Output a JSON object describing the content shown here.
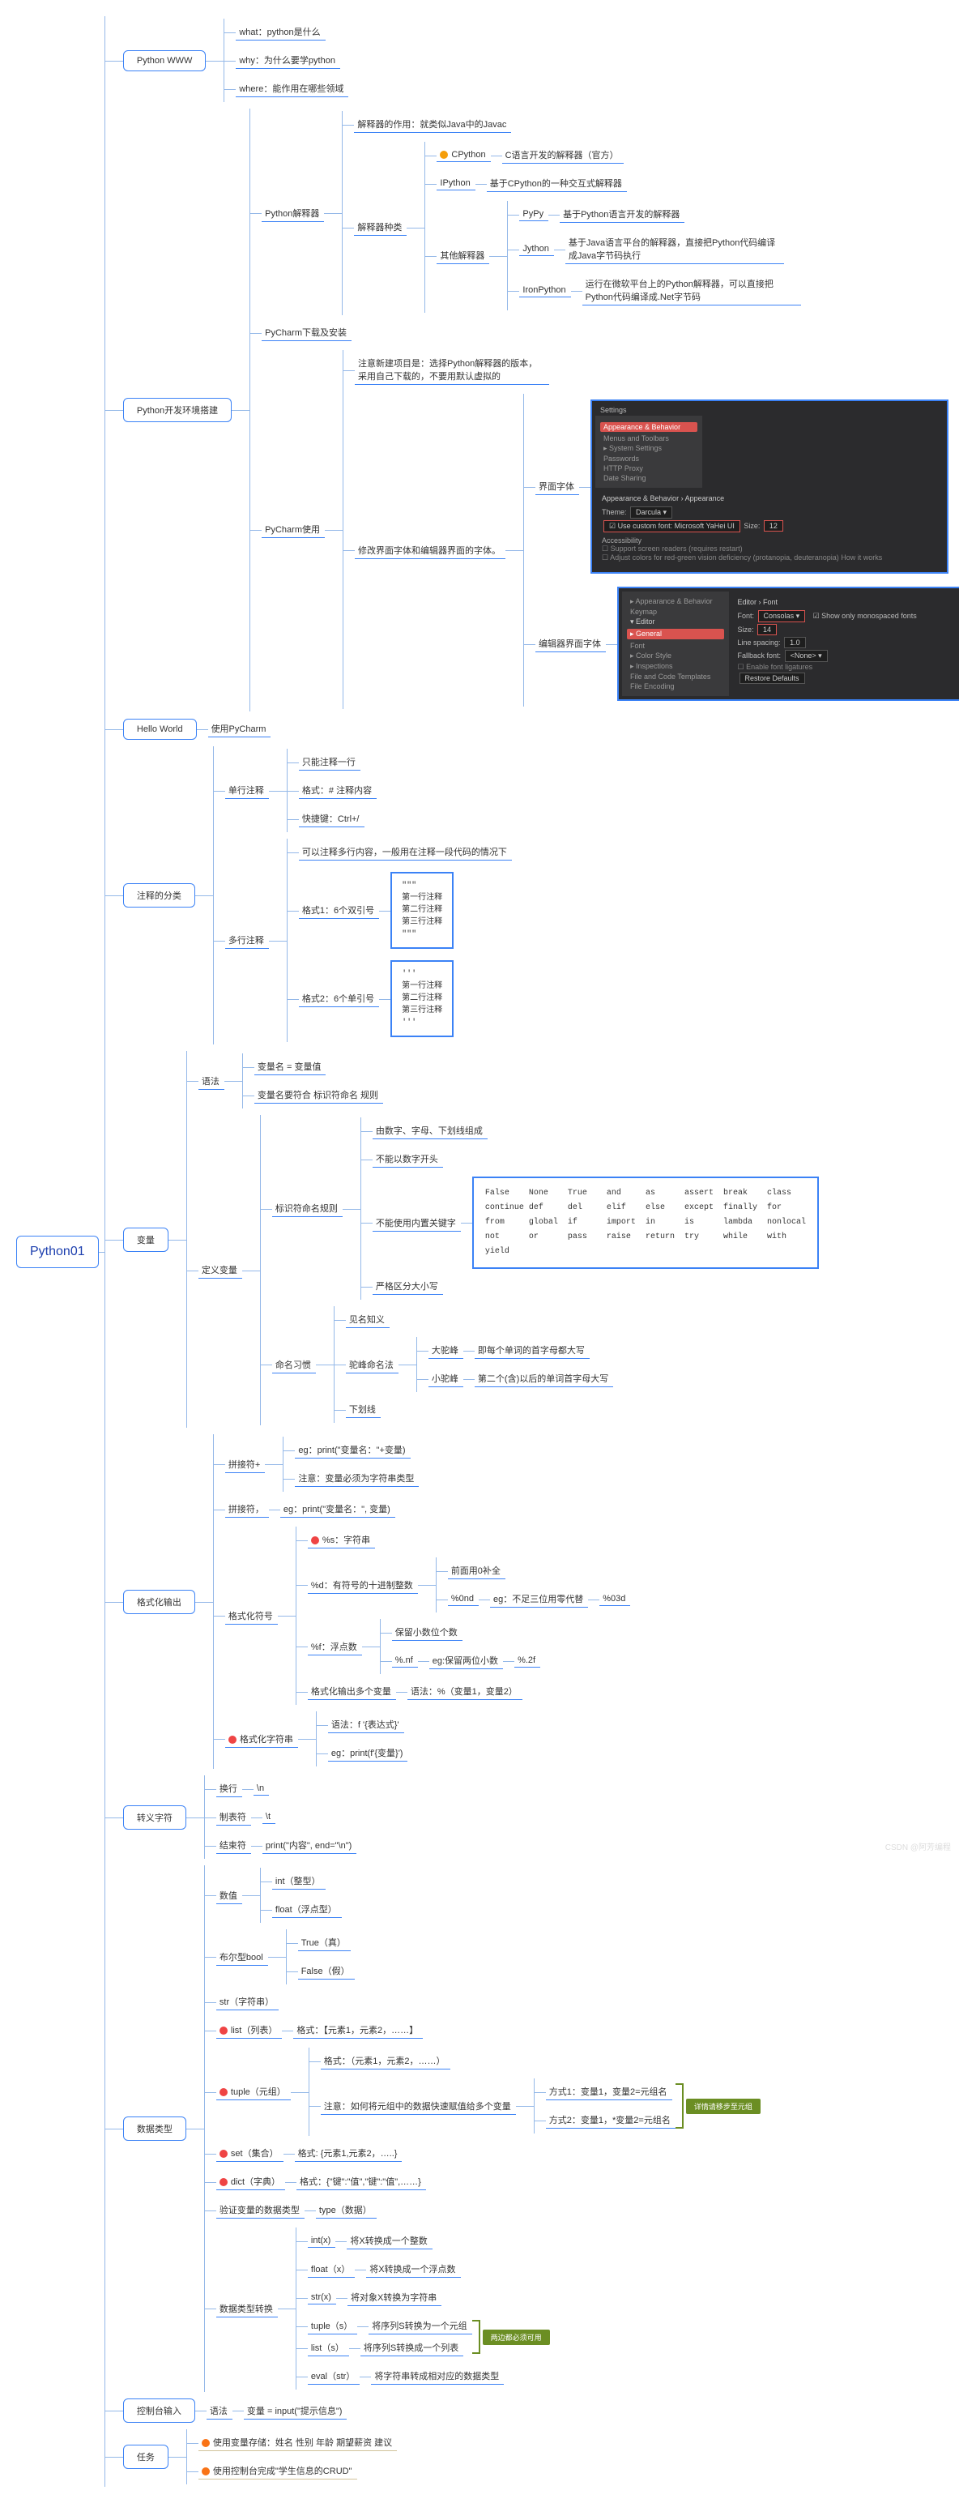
{
  "root": "Python01",
  "www": {
    "title": "Python WWW",
    "items": [
      "what：python是什么",
      "why：为什么要学python",
      "where：能作用在哪些领域"
    ]
  },
  "env": {
    "title": "Python开发环境搭建",
    "interp": {
      "title": "Python解释器",
      "role": "解释器的作用：就类似Java中的Javac",
      "kinds_label": "解释器种类",
      "cpython_dot": "●",
      "cpython": "CPython",
      "cpython_desc": "C语言开发的解释器（官方）",
      "ipython": "IPython",
      "ipython_desc": "基于CPython的一种交互式解释器",
      "other_label": "其他解释器",
      "pypy": "PyPy",
      "pypy_desc": "基于Python语言开发的解释器",
      "jython": "Jython",
      "jython_desc": "基于Java语言平台的解释器，直接把Python代码编译成Java字节码执行",
      "ironpython": "IronPython",
      "ironpython_desc": "运行在微软平台上的Python解释器，可以直接把Python代码编译成.Net字节码"
    },
    "pycharm_dl": "PyCharm下载及安装",
    "pycharm_use": {
      "title": "PyCharm使用",
      "new_proj": "注意新建项目是：选择Python解释器的版本，采用自己下载的，不要用默认虚拟的",
      "modify_font": "修改界面字体和编辑器界面的字体。",
      "ui_font": "界面字体",
      "editor_font": "编辑器界面字体",
      "ide1": {
        "title": "Settings",
        "crumb": "Appearance & Behavior › Appearance",
        "side_sel": "Appearance & Behavior",
        "side_items": [
          "Menus and Toolbars",
          "▸ System Settings",
          "Passwords",
          "HTTP Proxy",
          "Date Sharing"
        ],
        "theme_lbl": "Theme:",
        "theme_val": "Darcula ▾",
        "font_lbl": "Use custom font:",
        "font_val": "Microsoft YaHei UI",
        "size_lbl": "Size:",
        "size_val": "12",
        "acc": "Accessibility",
        "chk1": "Support screen readers (requires restart)",
        "chk2": "Adjust colors for red-green vision deficiency (protanopia, deuteranopia)  How it works"
      },
      "ide2": {
        "crumb": "Editor › Font",
        "side": [
          "▸ Appearance & Behavior",
          "Keymap",
          "▾ Editor",
          "▸ General",
          "Font",
          "▸ Color Style",
          "▸ Inspections",
          "File and Code Templates",
          "File Encoding"
        ],
        "font_lbl": "Font:",
        "font_val": "Consolas ▾",
        "size_lbl": "Size:",
        "size_val": "14",
        "ls_lbl": "Line spacing:",
        "ls_val": "1.0",
        "mono": "Show only monospaced fonts",
        "fb_lbl": "Fallback font:",
        "fb_val": "<None> ▾",
        "lig": "Enable font ligatures",
        "restore": "Restore Defaults"
      }
    }
  },
  "hello": {
    "title": "Hello World",
    "use": "使用PyCharm"
  },
  "comment": {
    "title": "注释的分类",
    "single": {
      "title": "单行注释",
      "one": "只能注释一行",
      "fmt": "格式：# 注释内容",
      "key": "快捷键：Ctrl+/"
    },
    "multi": {
      "title": "多行注释",
      "desc": "可以注释多行内容，一般用在注释一段代码的情况下",
      "f1": "格式1：6个双引号",
      "f2": "格式2：6个单引号",
      "code1": "\"\"\"\n第一行注释\n第二行注释\n第三行注释\n\"\"\"",
      "code2": "'''\n第一行注释\n第二行注释\n第三行注释\n'''"
    }
  },
  "var": {
    "title": "变量",
    "syntax": {
      "title": "语法",
      "eq": "变量名 = 变量值",
      "rule": "变量名要符合 标识符命名 规则"
    },
    "define": {
      "title": "定义变量",
      "idrule": {
        "title": "标识符命名规则",
        "r1": "由数字、字母、下划线组成",
        "r2": "不能以数字开头",
        "r3": "不能使用内置关键字",
        "r4": "严格区分大小写",
        "keywords": "False    None    True    and     as      assert  break    class\ncontinue def     del     elif    else    except  finally  for\nfrom     global  if      import  in      is      lambda   nonlocal\nnot      or      pass    raise   return  try     while    with\nyield"
      },
      "naming": {
        "title": "命名习惯",
        "n1": "见名知义",
        "camel": "驼峰命名法",
        "big": "大驼峰",
        "big_desc": "即每个单词的首字母都大写",
        "small": "小驼峰",
        "small_desc": "第二个(含)以后的单词首字母大写",
        "n3": "下划线"
      }
    }
  },
  "fmt": {
    "title": "格式化输出",
    "plus": {
      "title": "拼接符+",
      "eg": "eg：print(\"变量名：\"+变量)",
      "note": "注意：变量必须为字符串类型"
    },
    "comma": {
      "title": "拼接符，",
      "eg": "eg：print(\"变量名：\", 变量)"
    },
    "sym": {
      "title": "格式化符号",
      "s": "%s：字符串",
      "d": "%d：有符号的十进制整数",
      "d_pad": "前面用0补全",
      "d_fmt": "%0nd",
      "d_eg": "eg：不足三位用零代替",
      "d_eg2": "%03d",
      "f": "%f：浮点数",
      "f_keep": "保留小数位个数",
      "f_fmt": "%.nf",
      "f_eg": "eg:保留两位小数",
      "f_eg2": "%.2f",
      "multi": "格式化输出多个变量",
      "multi_s": "语法：%（变量1，变量2）"
    },
    "fstr": {
      "title": "格式化字符串",
      "syn": "语法：f '{表达式}'",
      "eg": "eg：print(f'{变量}')"
    }
  },
  "esc": {
    "title": "转义字符",
    "nl": "换行",
    "nl_v": "\\n",
    "tab": "制表符",
    "tab_v": "\\t",
    "end": "结束符",
    "end_v": "print(\"内容\", end=\"\\n\")"
  },
  "types": {
    "title": "数据类型",
    "num": {
      "title": "数值",
      "int": "int（整型）",
      "float": "float（浮点型）"
    },
    "bool": {
      "title": "布尔型bool",
      "t": "True（真）",
      "f": "False（假）"
    },
    "str": "str（字符串）",
    "list": {
      "title": "list（列表）",
      "fmt": "格式：【元素1，元素2，……】"
    },
    "tuple": {
      "title": "tuple（元组）",
      "fmt": "格式：（元素1，元素2，……）",
      "note": "注意：如何将元组中的数据快速赋值给多个变量",
      "m1": "方式1：变量1，变量2=元组名",
      "m2": "方式2：变量1，*变量2=元组名",
      "tag": "详情请移步至元组"
    },
    "set": {
      "title": "set（集合）",
      "fmt": "格式: {元素1,元素2，…..}"
    },
    "dict": {
      "title": "dict（字典）",
      "fmt": "格式：{\"键\":\"值\",\"键\":\"值\",……}"
    },
    "check": {
      "title": "验证变量的数据类型",
      "fn": "type（数据）"
    },
    "conv": {
      "title": "数据类型转换",
      "int": "int(x)",
      "int_d": "将X转换成一个整数",
      "float": "float（x）",
      "float_d": "将X转换成一个浮点数",
      "str": "str(x)",
      "str_d": "将对象X转换为字符串",
      "tuple": "tuple（s）",
      "tuple_d": "将序列S转换为一个元组",
      "list": "list（s）",
      "list_d": "将序列S转换成一个列表",
      "eval": "eval（str）",
      "eval_d": "将字符串转成相对应的数据类型",
      "tag": "两边都必须可用"
    }
  },
  "input": {
    "title": "控制台输入",
    "syn": "语法",
    "val": "变量 = input(\"提示信息\")"
  },
  "task": {
    "title": "任务",
    "t1": "使用变量存储：姓名 性别 年龄 期望薪资 建议",
    "t2": "使用控制台完成\"学生信息的CRUD\""
  },
  "watermark": "CSDN @阿芳编程"
}
